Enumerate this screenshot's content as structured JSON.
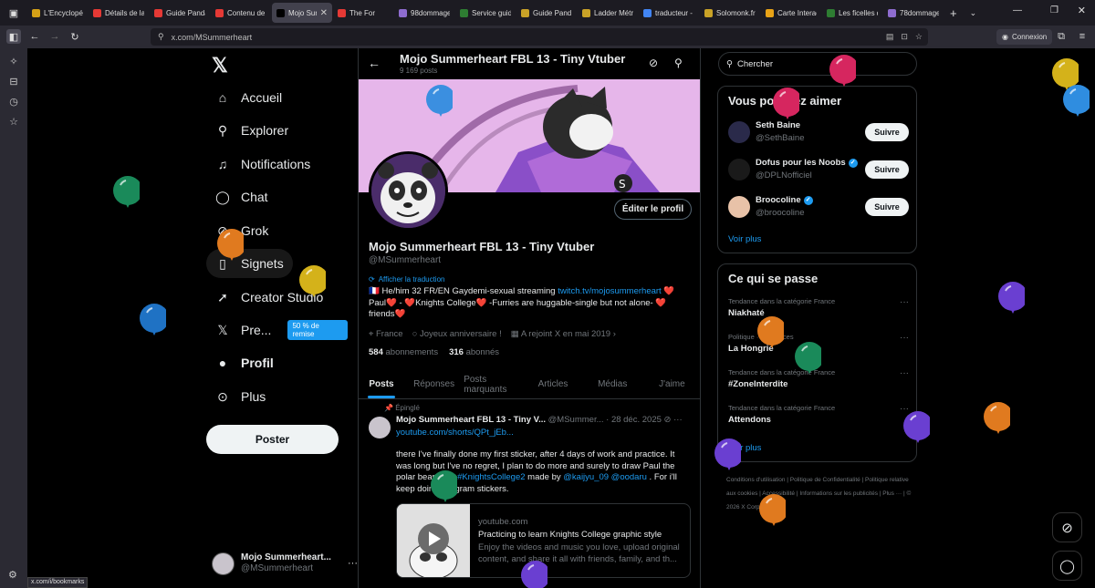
{
  "browser": {
    "tabs": [
      {
        "label": "L'Encyclopé",
        "color": "#d4a017"
      },
      {
        "label": "Détails de la",
        "color": "#e53935"
      },
      {
        "label": "Guide Panda",
        "color": "#e53935"
      },
      {
        "label": "Contenu de",
        "color": "#e53935"
      },
      {
        "label": "Mojo Sum",
        "color": "#000000",
        "active": true
      },
      {
        "label": "The For",
        "color": "#e53935"
      },
      {
        "label": "98dommage",
        "color": "#8e6ccf"
      },
      {
        "label": "Service guid",
        "color": "#2e7d32"
      },
      {
        "label": "Guide Pand",
        "color": "#c9a227"
      },
      {
        "label": "Ladder Métr",
        "color": "#c9a227"
      },
      {
        "label": "traducteur -",
        "color": "#4285f4"
      },
      {
        "label": "Solomonk.fr",
        "color": "#c9a227"
      },
      {
        "label": "Carte Interac",
        "color": "#e8a317"
      },
      {
        "label": "Les ficelles d",
        "color": "#2e7d32"
      },
      {
        "label": "78dommage",
        "color": "#8e6ccf"
      }
    ],
    "url": "x.com/MSummerheart",
    "connexion": "Connexion",
    "status_url": "x.com/i/bookmarks"
  },
  "nav": {
    "items": [
      {
        "label": "Accueil",
        "icon": "home-icon"
      },
      {
        "label": "Explorer",
        "icon": "search-icon"
      },
      {
        "label": "Notifications",
        "icon": "bell-icon"
      },
      {
        "label": "Chat",
        "icon": "chat-icon"
      },
      {
        "label": "Grok",
        "icon": "grok-icon"
      },
      {
        "label": "Signets",
        "icon": "bookmark-icon"
      },
      {
        "label": "Creator Studio",
        "icon": "rocket-icon"
      },
      {
        "label": "Pre...",
        "icon": "x-premium-icon"
      },
      {
        "label": "Profil",
        "icon": "person-icon"
      },
      {
        "label": "Plus",
        "icon": "more-circle-icon"
      }
    ],
    "promo": "50 % de remise",
    "post_button": "Poster",
    "account": {
      "name": "Mojo Summerheart...",
      "handle": "@MSummerheart"
    }
  },
  "profile": {
    "header_title": "Mojo Summerheart FBL 13 - Tiny Vtuber",
    "post_count": "9 169 posts",
    "edit": "Éditer le profil",
    "name": "Mojo Summerheart FBL 13 - Tiny Vtuber",
    "handle": "@MSummerheart",
    "translate": "Afficher la traduction",
    "bio_part1": "🇫🇷 He/him 32 FR/EN Gaydemi-sexual streaming ",
    "bio_link": "twitch.tv/mojosummerheart",
    "bio_part2": " ❤️ Paul❤️ - ❤️Knights College❤️ -Furries are huggable-single but not alone- ❤️ friends❤️",
    "location": "France",
    "birthday": "Joyeux anniversaire !",
    "joined": "A rejoint X en mai 2019",
    "following_count": "584",
    "following_label": "abonnements",
    "followers_count": "316",
    "followers_label": "abonnés",
    "tabs": [
      "Posts",
      "Réponses",
      "Posts marquants",
      "Articles",
      "Médias",
      "J'aime"
    ]
  },
  "tweet": {
    "pinned": "Épinglé",
    "author": "Mojo Summerheart FBL 13 - Tiny V...",
    "handle_date": "@MSummer... · 28 déc. 2025",
    "link": "youtube.com/shorts/QPt_jEb...",
    "text1": "there I've finally done my first sticker, after 4 days of work and practice. It was long but I've no regret, I plan to do more and surely to draw Paul the polar bear from ",
    "hashtag": "#KnightsCollege2",
    "text2": " made by ",
    "mentions": "@kaijyu_09 @oodaru",
    "text3": " . For i'll keep doing telegram stickers.",
    "card": {
      "domain": "youtube.com",
      "title": "Practicing to learn Knights College graphic style",
      "desc": "Enjoy the videos and music you love, upload original content, and share it all with friends, family, and th..."
    }
  },
  "sidebar": {
    "search_placeholder": "Chercher",
    "suggest_title": "Vous pourriez aimer",
    "suggestions": [
      {
        "name": "Seth Baine",
        "handle": "@SethBaine",
        "verified": false,
        "color": "#2a2a4a"
      },
      {
        "name": "Dofus pour les Noobs",
        "handle": "@DPLNofficiel",
        "verified": true,
        "color": "#1a1a1a"
      },
      {
        "name": "Broocoline",
        "handle": "@broocoline",
        "verified": true,
        "color": "#e8c2a8"
      }
    ],
    "follow_label": "Suivre",
    "see_more": "Voir plus",
    "trends_title": "Ce qui se passe",
    "trends": [
      {
        "category": "Tendance dans la catégorie France",
        "name": "Niakhaté"
      },
      {
        "category": "Politique · Tendances",
        "name": "La Hongrie"
      },
      {
        "category": "Tendance dans la catégorie France",
        "name": "#ZoneInterdite"
      },
      {
        "category": "Tendance dans la catégorie France",
        "name": "Attendons"
      }
    ],
    "trends_more": "Voir plus",
    "footer": "Conditions d'utilisation | Politique de Confidentialité | Politique relative aux cookies | Accessibilité | Informations sur les publicités | Plus ··· | © 2026 X Corp."
  },
  "balloons": [
    {
      "color": "#1a8a5a"
    },
    {
      "color": "#1f72c4"
    },
    {
      "color": "#e07a1f"
    },
    {
      "color": "#d4b21a"
    },
    {
      "color": "#3b8fe0"
    },
    {
      "color": "#d6265f"
    },
    {
      "color": "#d6265f"
    },
    {
      "color": "#d4b21a"
    },
    {
      "color": "#2f8de0"
    },
    {
      "color": "#6a3fd1"
    },
    {
      "color": "#e07a1f"
    },
    {
      "color": "#1a8a5a"
    },
    {
      "color": "#6a3fd1"
    },
    {
      "color": "#e07a1f"
    },
    {
      "color": "#6a3fd1"
    },
    {
      "color": "#e07a1f"
    },
    {
      "color": "#1a8a5a"
    },
    {
      "color": "#6a3fd1"
    }
  ]
}
